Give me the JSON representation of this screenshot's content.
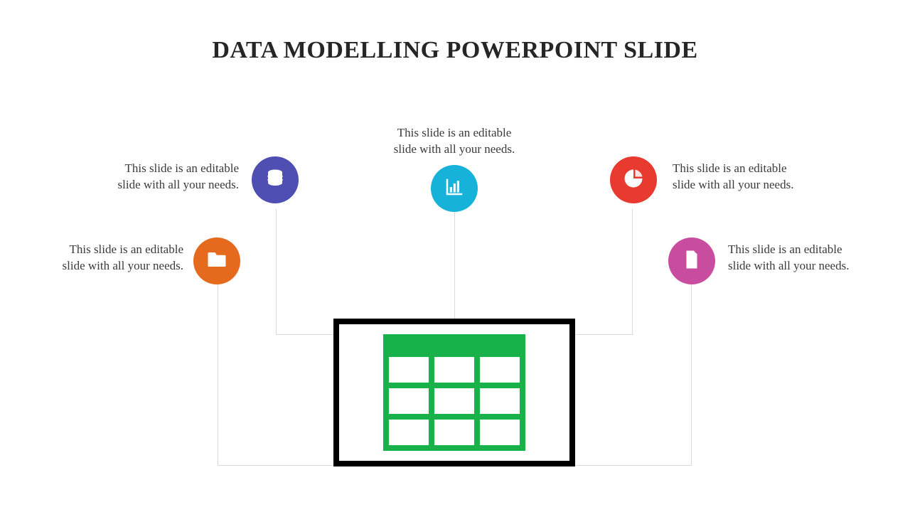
{
  "title": "DATA MODELLING POWERPOINT SLIDE",
  "nodes": {
    "n1": {
      "line1": "This slide is an editable",
      "line2": "slide with all your needs.",
      "color": "#e56a1d"
    },
    "n2": {
      "line1": "This slide is an editable",
      "line2": "slide with all your needs.",
      "color": "#4f4eb3"
    },
    "n3": {
      "line1": "This slide is an editable",
      "line2": "slide with all your needs.",
      "color": "#17b2d9"
    },
    "n4": {
      "line1": "This slide is an editable",
      "line2": "slide with all your needs.",
      "color": "#e83a2e"
    },
    "n5": {
      "line1": "This slide is an editable",
      "line2": "slide with all your needs.",
      "color": "#c94d9e"
    }
  },
  "central": {
    "color": "#17b24a"
  }
}
